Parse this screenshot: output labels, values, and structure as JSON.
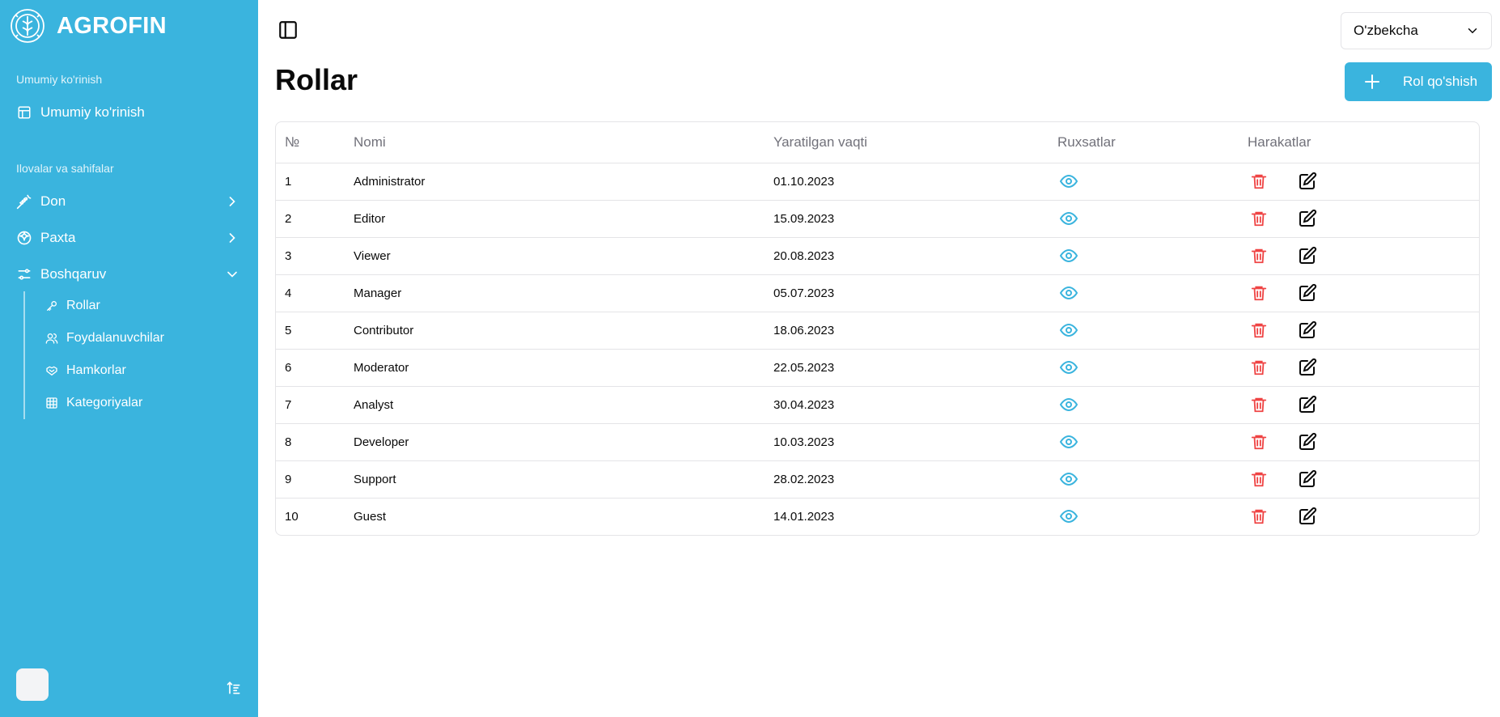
{
  "brand": {
    "name": "AGROFIN"
  },
  "sidebar": {
    "group1_label": "Umumiy ko'rinish",
    "overview_label": "Umumiy ko'rinish",
    "group2_label": "Ilovalar va sahifalar",
    "items": [
      {
        "label": "Don"
      },
      {
        "label": "Paxta"
      },
      {
        "label": "Boshqaruv"
      }
    ],
    "sub_items": [
      {
        "label": "Rollar"
      },
      {
        "label": "Foydalanuvchilar"
      },
      {
        "label": "Hamkorlar"
      },
      {
        "label": "Kategoriyalar"
      }
    ]
  },
  "header": {
    "language": "O'zbekcha"
  },
  "page": {
    "title": "Rollar",
    "add_button": "Rol qo'shish"
  },
  "table": {
    "columns": [
      "№",
      "Nomi",
      "Yaratilgan vaqti",
      "Ruxsatlar",
      "Harakatlar"
    ],
    "rows": [
      {
        "no": "1",
        "name": "Administrator",
        "created": "01.10.2023"
      },
      {
        "no": "2",
        "name": "Editor",
        "created": "15.09.2023"
      },
      {
        "no": "3",
        "name": "Viewer",
        "created": "20.08.2023"
      },
      {
        "no": "4",
        "name": "Manager",
        "created": "05.07.2023"
      },
      {
        "no": "5",
        "name": "Contributor",
        "created": "18.06.2023"
      },
      {
        "no": "6",
        "name": "Moderator",
        "created": "22.05.2023"
      },
      {
        "no": "7",
        "name": "Analyst",
        "created": "30.04.2023"
      },
      {
        "no": "8",
        "name": "Developer",
        "created": "10.03.2023"
      },
      {
        "no": "9",
        "name": "Support",
        "created": "28.02.2023"
      },
      {
        "no": "10",
        "name": "Guest",
        "created": "14.01.2023"
      }
    ]
  },
  "colors": {
    "brand": "#3ab4de",
    "danger": "#ef4444",
    "text": "#0a0a0a",
    "muted": "#71717a"
  },
  "icons": {
    "view": "eye-icon",
    "delete": "trash-icon",
    "edit": "edit-icon"
  }
}
